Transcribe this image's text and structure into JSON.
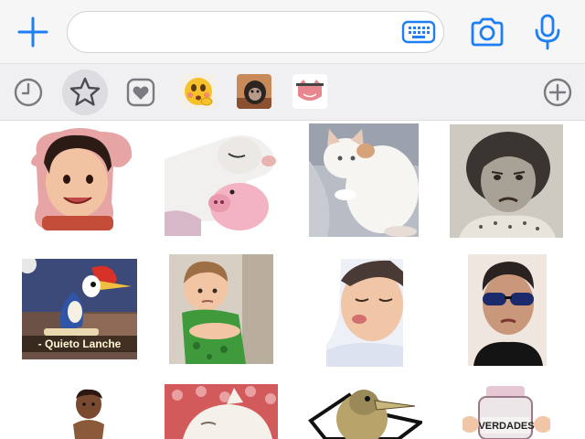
{
  "composer": {
    "message_value": "",
    "message_placeholder": ""
  },
  "colors": {
    "accent": "#1e7ef5",
    "tray_icon": "#7a7a80",
    "background": "#f6f6f7"
  },
  "icons": {
    "add": "plus-icon",
    "keyboard": "keyboard-icon",
    "camera": "camera-icon",
    "mic": "microphone-icon",
    "recent": "clock-icon",
    "favorites": "star-icon",
    "heart": "heart-icon",
    "add_pack": "circle-plus-icon"
  },
  "sticker_tray": {
    "active_tab": "favorites",
    "packs": [
      "emoji-face-pack",
      "monkey-pack",
      "cat-hearts-pack"
    ]
  },
  "stickers": [
    {
      "id": "girl-smiling"
    },
    {
      "id": "goat-and-pig"
    },
    {
      "id": "white-cat-lying"
    },
    {
      "id": "vintage-girl-frown"
    },
    {
      "id": "woody-woodpecker",
      "caption": "- Quieto Lanche"
    },
    {
      "id": "boy-arms-crossed"
    },
    {
      "id": "child-pouting"
    },
    {
      "id": "man-sunglasses-pout"
    },
    {
      "id": "baby-standing"
    },
    {
      "id": "cat-in-bed"
    },
    {
      "id": "meme-bird"
    },
    {
      "id": "jar-verdades",
      "caption": "VERDADES"
    }
  ]
}
